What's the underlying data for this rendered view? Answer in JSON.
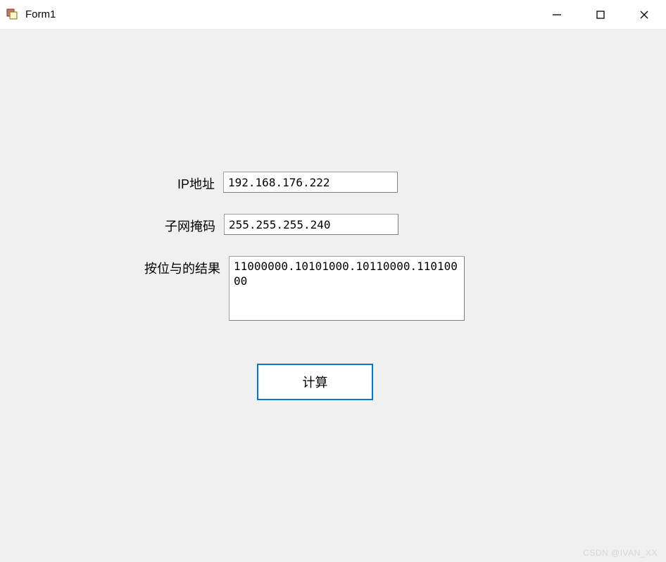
{
  "window": {
    "title": "Form1"
  },
  "form": {
    "ip_label": "IP地址",
    "ip_value": "192.168.176.222",
    "mask_label": "子网掩码",
    "mask_value": "255.255.255.240",
    "result_label": "按位与的结果",
    "result_value": "11000000.10101000.10110000.11010000",
    "calc_button": "计算"
  },
  "watermark": "CSDN @IVAN_XX"
}
